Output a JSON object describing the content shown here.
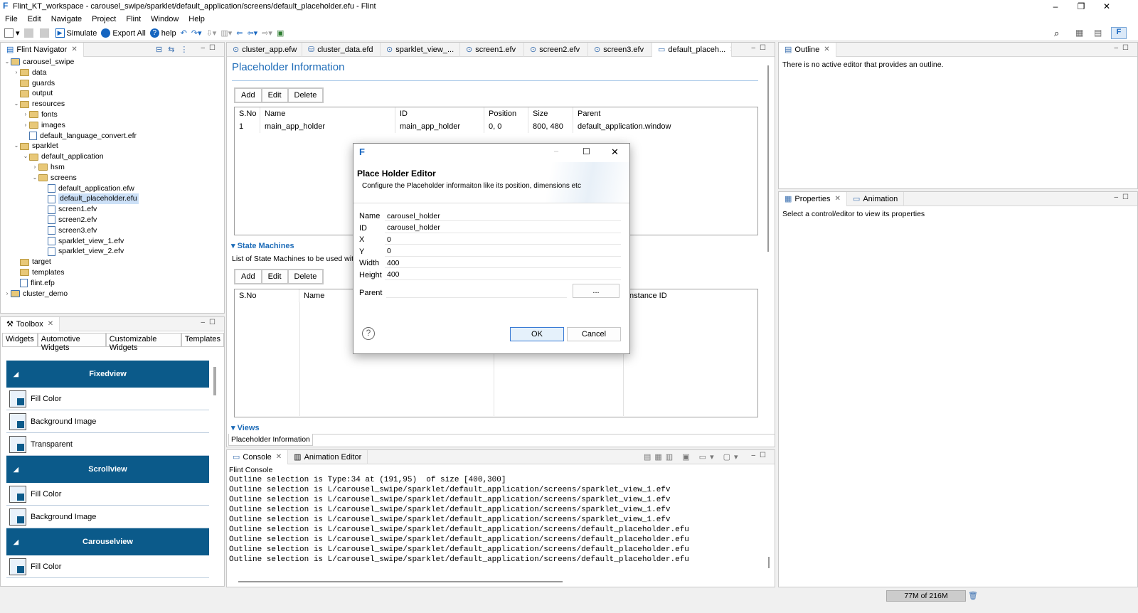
{
  "window": {
    "title": "Flint_KT_workspace - carousel_swipe/sparklet/default_application/screens/default_placeholder.efu - Flint",
    "minimize": "–",
    "maximize": "❐",
    "close": "✕"
  },
  "menu": [
    "File",
    "Edit",
    "Navigate",
    "Project",
    "Flint",
    "Window",
    "Help"
  ],
  "toolbar": {
    "simulate": "Simulate",
    "export_all": "Export All",
    "help": "help"
  },
  "navigator": {
    "title": "Flint Navigator",
    "items": [
      {
        "label": "carousel_swipe",
        "indent": 0,
        "arrow": "v",
        "kind": "project"
      },
      {
        "label": "data",
        "indent": 1,
        "arrow": ">",
        "kind": "folder"
      },
      {
        "label": "guards",
        "indent": 1,
        "arrow": "",
        "kind": "folder"
      },
      {
        "label": "output",
        "indent": 1,
        "arrow": "",
        "kind": "folder"
      },
      {
        "label": "resources",
        "indent": 1,
        "arrow": "v",
        "kind": "folder"
      },
      {
        "label": "fonts",
        "indent": 2,
        "arrow": ">",
        "kind": "folder"
      },
      {
        "label": "images",
        "indent": 2,
        "arrow": ">",
        "kind": "folder"
      },
      {
        "label": "default_language_convert.efr",
        "indent": 2,
        "arrow": "",
        "kind": "file"
      },
      {
        "label": "sparklet",
        "indent": 1,
        "arrow": "v",
        "kind": "folder"
      },
      {
        "label": "default_application",
        "indent": 2,
        "arrow": "v",
        "kind": "folder"
      },
      {
        "label": "hsm",
        "indent": 3,
        "arrow": ">",
        "kind": "folder"
      },
      {
        "label": "screens",
        "indent": 3,
        "arrow": "v",
        "kind": "folder"
      },
      {
        "label": "default_application.efw",
        "indent": 4,
        "arrow": "",
        "kind": "file"
      },
      {
        "label": "default_placeholder.efu",
        "indent": 4,
        "arrow": "",
        "kind": "file",
        "selected": true
      },
      {
        "label": "screen1.efv",
        "indent": 4,
        "arrow": "",
        "kind": "file"
      },
      {
        "label": "screen2.efv",
        "indent": 4,
        "arrow": "",
        "kind": "file"
      },
      {
        "label": "screen3.efv",
        "indent": 4,
        "arrow": "",
        "kind": "file"
      },
      {
        "label": "sparklet_view_1.efv",
        "indent": 4,
        "arrow": "",
        "kind": "file"
      },
      {
        "label": "sparklet_view_2.efv",
        "indent": 4,
        "arrow": "",
        "kind": "file"
      },
      {
        "label": "target",
        "indent": 1,
        "arrow": "",
        "kind": "folder"
      },
      {
        "label": "templates",
        "indent": 1,
        "arrow": "",
        "kind": "folder"
      },
      {
        "label": "flint.efp",
        "indent": 1,
        "arrow": "",
        "kind": "file"
      },
      {
        "label": "cluster_demo",
        "indent": 0,
        "arrow": ">",
        "kind": "project"
      }
    ]
  },
  "toolbox": {
    "title": "Toolbox",
    "tabs": [
      "Widgets",
      "Automotive Widgets",
      "Customizable Widgets",
      "Templates"
    ],
    "groups": [
      {
        "name": "Fixedview",
        "items": [
          "Fill Color",
          "Background Image",
          "Transparent"
        ]
      },
      {
        "name": "Scrollview",
        "items": [
          "Fill Color",
          "Background Image"
        ]
      },
      {
        "name": "Carouselview",
        "items": [
          "Fill Color"
        ]
      }
    ]
  },
  "editor_tabs": [
    "cluster_app.efw",
    "cluster_data.efd",
    "sparklet_view_...",
    "screen1.efv",
    "screen2.efv",
    "screen3.efv",
    "default_placeh..."
  ],
  "placeholder_info": {
    "heading": "Placeholder Information",
    "add": "Add",
    "edit": "Edit",
    "delete": "Delete",
    "columns": [
      "S.No",
      "Name",
      "ID",
      "Position",
      "Size",
      "Parent"
    ],
    "rows": [
      [
        "1",
        "main_app_holder",
        "main_app_holder",
        "0, 0",
        "800, 480",
        "default_application.window"
      ]
    ]
  },
  "state_machines": {
    "heading": "State Machines",
    "desc": "List of State Machines to be used with",
    "columns": [
      "S.No",
      "Name",
      "",
      "Instance ID"
    ]
  },
  "views": {
    "heading": "Views",
    "tab": "Placeholder Information"
  },
  "console": {
    "tabs": [
      "Console",
      "Animation Editor"
    ],
    "label": "Flint Console",
    "lines": [
      "Outline selection is Type:34 at (191,95)  of size [400,300]",
      "Outline selection is L/carousel_swipe/sparklet/default_application/screens/sparklet_view_1.efv",
      "Outline selection is L/carousel_swipe/sparklet/default_application/screens/sparklet_view_1.efv",
      "Outline selection is L/carousel_swipe/sparklet/default_application/screens/sparklet_view_1.efv",
      "Outline selection is L/carousel_swipe/sparklet/default_application/screens/sparklet_view_1.efv",
      "Outline selection is L/carousel_swipe/sparklet/default_application/screens/default_placeholder.efu",
      "Outline selection is L/carousel_swipe/sparklet/default_application/screens/default_placeholder.efu",
      "Outline selection is L/carousel_swipe/sparklet/default_application/screens/default_placeholder.efu",
      "Outline selection is L/carousel_swipe/sparklet/default_application/screens/default_placeholder.efu"
    ]
  },
  "outline": {
    "title": "Outline",
    "message": "There is no active editor that provides an outline."
  },
  "properties": {
    "title": "Properties",
    "tab2": "Animation",
    "message": "Select a control/editor to view its properties"
  },
  "status": {
    "memory": "77M of 216M"
  },
  "dialog": {
    "title": "Place Holder Editor",
    "subtitle": "Configure the Placeholder informaiton like its position, dimensions etc",
    "fields": [
      {
        "label": "Name",
        "value": "carousel_holder"
      },
      {
        "label": "ID",
        "value": "carousel_holder"
      },
      {
        "label": "X",
        "value": "0"
      },
      {
        "label": "Y",
        "value": "0"
      },
      {
        "label": "Width",
        "value": "400"
      },
      {
        "label": "Height",
        "value": "400"
      }
    ],
    "parent_label": "Parent",
    "parent_value": "",
    "browse": "...",
    "ok": "OK",
    "cancel": "Cancel",
    "help_glyph": "?"
  }
}
